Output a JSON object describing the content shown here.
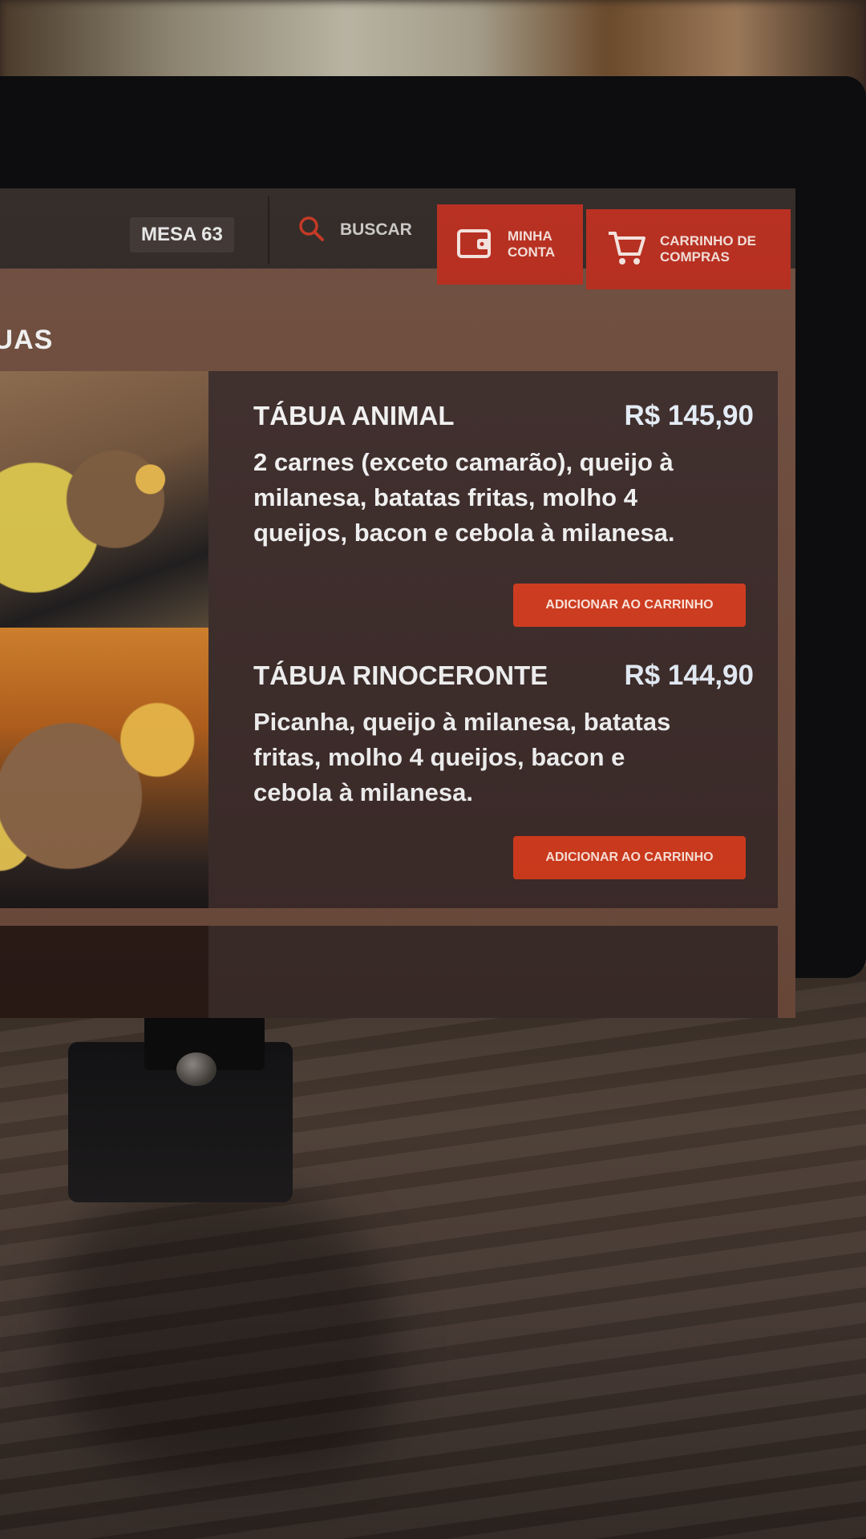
{
  "header": {
    "table_label": "MESA 63",
    "search_label": "BUSCAR",
    "account_label_line1": "MINHA",
    "account_label_line2": "CONTA",
    "cart_label_line1": "CARRINHO DE",
    "cart_label_line2": "COMPRAS"
  },
  "category": {
    "title": "BUAS"
  },
  "products": [
    {
      "name": "TÁBUA ANIMAL",
      "price": "R$ 145,90",
      "description": "2 carnes (exceto camarão), queijo à milanesa, batatas fritas, molho 4 queijos, bacon e cebola à milanesa.",
      "button_label": "ADICIONAR AO CARRINHO"
    },
    {
      "name": "TÁBUA RINOCERONTE",
      "price": "R$ 144,90",
      "description": "Picanha, queijo à milanesa, batatas fritas, molho 4 queijos, bacon e cebola à milanesa.",
      "button_label": "ADICIONAR AO CARRINHO"
    }
  ],
  "colors": {
    "accent": "#b5291a",
    "button": "#d13a1c",
    "card_bg": "#3b2a28",
    "screen_bg": "#6c4a3b",
    "topbar_bg": "#2d2522"
  },
  "icons": [
    "search-icon",
    "wallet-icon",
    "cart-icon"
  ]
}
